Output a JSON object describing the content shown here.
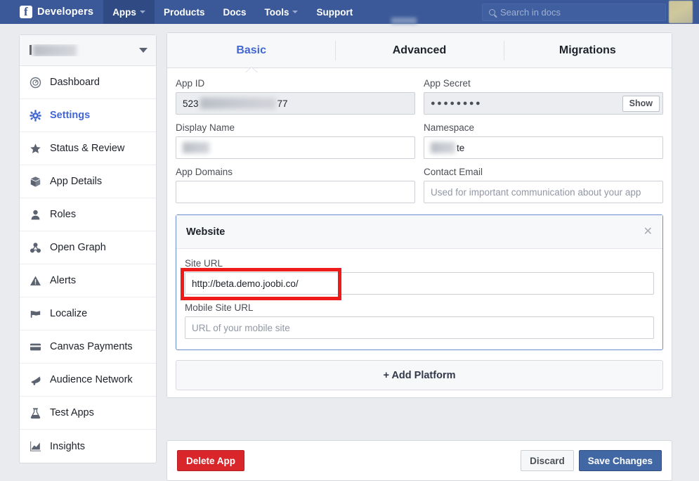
{
  "topnav": {
    "brand": "Developers",
    "brand_icon": "facebook-logo-icon",
    "items": [
      {
        "label": "Apps",
        "has_caret": true,
        "active": true
      },
      {
        "label": "Products",
        "has_caret": false,
        "active": false
      },
      {
        "label": "Docs",
        "has_caret": false,
        "active": false
      },
      {
        "label": "Tools",
        "has_caret": true,
        "active": false
      },
      {
        "label": "Support",
        "has_caret": false,
        "active": false
      }
    ],
    "search_placeholder": "Search in docs",
    "search_icon": "search-icon",
    "avatar_label": "",
    "bg_color": "#3b5998",
    "active_bg_color": "#304b84"
  },
  "sidebar": {
    "app_selector_label": "",
    "items": [
      {
        "label": "Dashboard",
        "icon": "gauge-icon",
        "active": false
      },
      {
        "label": "Settings",
        "icon": "gear-icon",
        "active": true
      },
      {
        "label": "Status & Review",
        "icon": "star-icon",
        "active": false
      },
      {
        "label": "App Details",
        "icon": "cube-icon",
        "active": false
      },
      {
        "label": "Roles",
        "icon": "person-icon",
        "active": false
      },
      {
        "label": "Open Graph",
        "icon": "molecule-icon",
        "active": false
      },
      {
        "label": "Alerts",
        "icon": "warning-triangle-icon",
        "active": false
      },
      {
        "label": "Localize",
        "icon": "flag-icon",
        "active": false
      },
      {
        "label": "Canvas Payments",
        "icon": "credit-card-icon",
        "active": false
      },
      {
        "label": "Audience Network",
        "icon": "megaphone-icon",
        "active": false
      },
      {
        "label": "Test Apps",
        "icon": "flask-icon",
        "active": false
      },
      {
        "label": "Insights",
        "icon": "line-chart-icon",
        "active": false
      }
    ],
    "active_color": "#4267d4"
  },
  "tabs": [
    {
      "label": "Basic",
      "active": true
    },
    {
      "label": "Advanced",
      "active": false
    },
    {
      "label": "Migrations",
      "active": false
    }
  ],
  "form": {
    "app_id": {
      "label": "App ID",
      "value_prefix": "523",
      "value_suffix": "77",
      "redacted": true
    },
    "app_secret": {
      "label": "App Secret",
      "value": "●●●●●●●●",
      "show_label": "Show"
    },
    "display_name": {
      "label": "Display Name",
      "value_prefix": "",
      "value_suffix": "",
      "redacted": true
    },
    "namespace": {
      "label": "Namespace",
      "value_prefix": "",
      "value_suffix": "te",
      "redacted": true
    },
    "app_domains": {
      "label": "App Domains",
      "value": "",
      "placeholder": ""
    },
    "contact_email": {
      "label": "Contact Email",
      "value": "",
      "placeholder": "Used for important communication about your app"
    }
  },
  "platform": {
    "title": "Website",
    "close_icon": "close-icon",
    "site_url": {
      "label": "Site URL",
      "value": "http://beta.demo.joobi.co/"
    },
    "mobile_site_url": {
      "label": "Mobile Site URL",
      "value": "",
      "placeholder": "URL of your mobile site"
    },
    "highlight_color": "#ee1b1b",
    "border_color": "#6d8ad4"
  },
  "add_platform": {
    "label": "+ Add Platform"
  },
  "footer": {
    "delete_label": "Delete App",
    "discard_label": "Discard",
    "save_label": "Save Changes",
    "delete_color": "#d9262b",
    "save_color": "#4267a5"
  }
}
